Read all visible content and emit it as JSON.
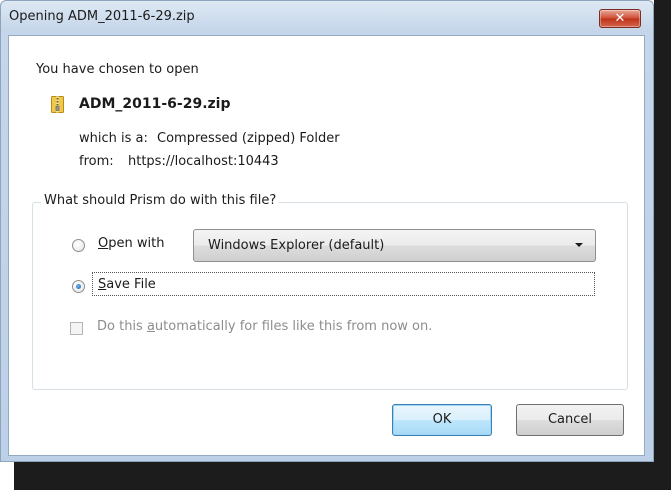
{
  "window": {
    "title": "Opening ADM_2011-6-29.zip",
    "close_glyph": "✕"
  },
  "body": {
    "chosen_text": "You have chosen to open",
    "file_icon": "zip-folder-icon",
    "filename": "ADM_2011-6-29.zip",
    "which_label": "which is a:",
    "which_value": "Compressed (zipped) Folder",
    "from_label": "from:",
    "from_value": "https://localhost:10443"
  },
  "group": {
    "legend": "What should Prism do with this file?",
    "open_with": {
      "access_key": "O",
      "rest": "pen with",
      "selected": false
    },
    "app_select": {
      "value": "Windows Explorer (default)"
    },
    "save_file": {
      "access_key": "S",
      "rest": "ave File",
      "selected": true
    },
    "auto": {
      "prefix": "Do this ",
      "access_key": "a",
      "suffix": "utomatically for files like this from now on.",
      "checked": false,
      "enabled": false
    }
  },
  "buttons": {
    "ok_label": "OK",
    "cancel_label": "Cancel"
  },
  "colors": {
    "titlebar": "#c5d6ea",
    "close_button": "#cf4a33",
    "default_button_border": "#3c7fb1",
    "disabled_text": "#8d8d8d"
  }
}
